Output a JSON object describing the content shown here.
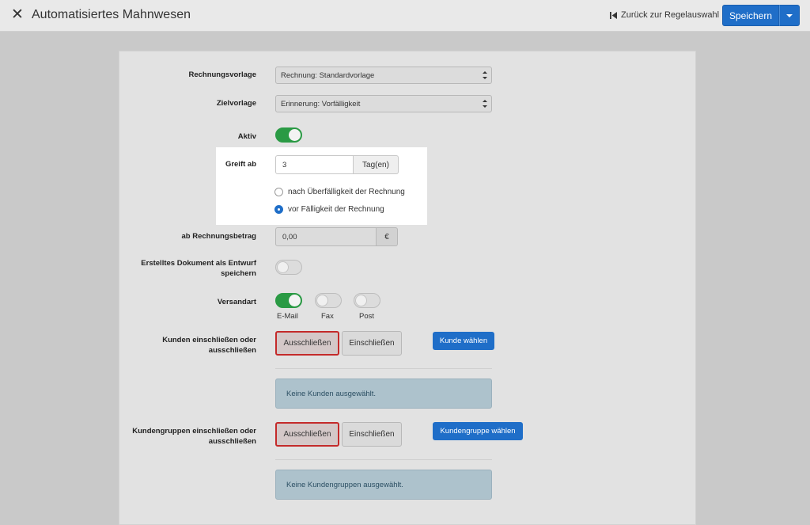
{
  "header": {
    "title": "Automatisiertes Mahnwesen",
    "back_label": "Zurück zur Regelauswahl",
    "save_label": "Speichern"
  },
  "form": {
    "invoice_template": {
      "label": "Rechnungsvorlage",
      "value": "Rechnung: Standardvorlage"
    },
    "target_template": {
      "label": "Zielvorlage",
      "value": "Erinnerung: Vorfälligkeit"
    },
    "active": {
      "label": "Aktiv",
      "on": true
    },
    "applies_from": {
      "label": "Greift ab",
      "value": "3",
      "unit": "Tag(en)",
      "options": [
        {
          "label": "nach Überfälligkeit der Rechnung",
          "checked": false
        },
        {
          "label": "vor Fälligkeit der Rechnung",
          "checked": true
        }
      ]
    },
    "min_amount": {
      "label": "ab Rechnungsbetrag",
      "value": "0,00",
      "unit": "€"
    },
    "draft": {
      "label": "Erstelltes Dokument als Entwurf speichern",
      "on": false
    },
    "shipping": {
      "label": "Versandart",
      "options": [
        {
          "label": "E-Mail",
          "on": true
        },
        {
          "label": "Fax",
          "on": false
        },
        {
          "label": "Post",
          "on": false
        }
      ]
    },
    "customers": {
      "label": "Kunden einschließen oder ausschließen",
      "exclude_label": "Ausschließen",
      "include_label": "Einschließen",
      "choose_label": "Kunde wählen",
      "empty_text": "Keine Kunden ausgewählt."
    },
    "customer_groups": {
      "label": "Kundengruppen einschließen oder ausschließen",
      "exclude_label": "Ausschließen",
      "include_label": "Einschließen",
      "choose_label": "Kundengruppe wählen",
      "empty_text": "Keine Kundengruppen ausgewählt."
    }
  },
  "colors": {
    "primary": "#1f6ec8",
    "toggle_on": "#2a9a44",
    "danger_border": "#c42a2a"
  }
}
